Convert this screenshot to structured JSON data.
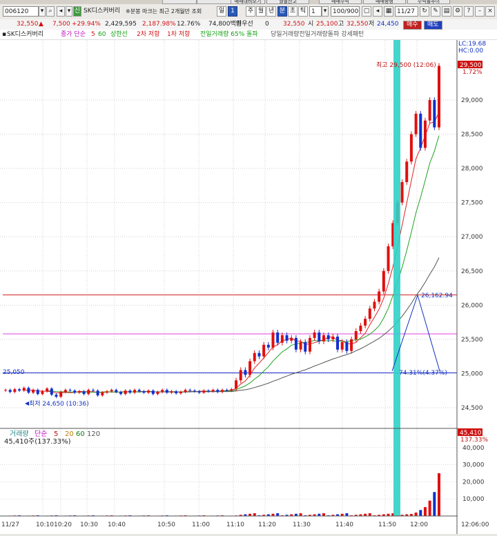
{
  "top_tabs": [
    "",
    "",
    "",
    "매매대비모기",
    "월별잔고",
    "매매수익",
    "매매종평",
    "수익률추이"
  ],
  "toolbar": {
    "code": "006120",
    "name": "SK디스커버리",
    "notice": "※분봉 마크는 최근 2개월만 조회",
    "periods": [
      "일",
      "1",
      "주",
      "월",
      "년",
      "분",
      "초",
      "틱"
    ],
    "active_period": "분",
    "interval": "1",
    "count": "100/900",
    "date": "11/27"
  },
  "quote": {
    "price": "32,550",
    "change": "7,500",
    "rate": "+29.94%",
    "volume": "2,429,595",
    "vol_rate": "2,187.98%",
    "pct2": "12.76%",
    "amount": "74,800백만",
    "amount_label": "최우선",
    "zero": "0",
    "ask": "32,550",
    "open_label": "시",
    "open": "25,100",
    "high_label": "고",
    "high": "32,550",
    "low_label": "저",
    "low": "24,450",
    "buy": "매수",
    "sell": "매도"
  },
  "legend": {
    "name": "SK디스커버리",
    "ma_label": "종가 단순",
    "ma5": "5",
    "ma60": "60",
    "upper": "상한선",
    "second_high": "2차 저항",
    "first_high": "1차 저항",
    "vol_text": "전일거래량 65% 돌파",
    "vol_text2": "당일거래량전일거래량돌파 강세패턴"
  },
  "chart_data": {
    "type": "candlestick",
    "y_ticks": [
      "29,000",
      "28,500",
      "28,000",
      "27,500",
      "27,000",
      "26,500",
      "26,000",
      "25,500",
      "25,000",
      "24,500"
    ],
    "x_ticks": [
      "11/27",
      "10:10",
      "10:20",
      "10:30",
      "10:40",
      "10:50",
      "11:00",
      "11:10",
      "11:20",
      "11:30",
      "11:40",
      "11:50",
      "12:00",
      "12:06:00"
    ],
    "max_label": "최고 29,500 (12:06)",
    "min_label": "최저 24,650 (10:36)",
    "last_price": "29,500",
    "last_pct": "1.72%",
    "lc": "LC:19.68",
    "hc": "HC:0.00",
    "line_25050": "25,050",
    "pivot": "26,162.94",
    "pivot_diff": "74.31%(4.37%)",
    "hlines": [
      {
        "price": 26150,
        "color": "#d02020"
      },
      {
        "price": 25580,
        "color": "#e040e0"
      },
      {
        "price": 25010,
        "color": "#2030d0"
      }
    ],
    "volume": {
      "label": "거래량",
      "ma_label": "단순",
      "ma": [
        "5",
        "20",
        "60",
        "120"
      ],
      "current": "45,410주(137.33%)",
      "last": "45,410",
      "last_pct": "137.33%",
      "ticks": [
        "40,000",
        "30,000",
        "20,000",
        "10,000"
      ]
    }
  }
}
